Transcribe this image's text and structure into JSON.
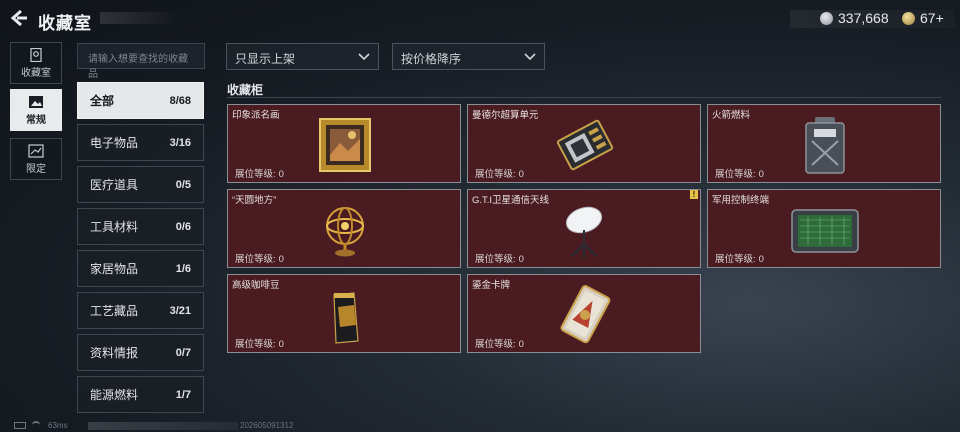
{
  "header": {
    "title": "收藏室",
    "currency_1": "337,668",
    "currency_2": "67+"
  },
  "rail": [
    {
      "label": "收藏室",
      "icon": "collection-room-icon"
    },
    {
      "label": "常规",
      "icon": "image-frame-icon"
    },
    {
      "label": "限定",
      "icon": "limited-icon"
    }
  ],
  "search": {
    "placeholder": "请输入想要查找的收藏品"
  },
  "filters": {
    "shelf": "只显示上架",
    "sort": "按价格降序"
  },
  "categories": [
    {
      "label": "全部",
      "count": "8/68"
    },
    {
      "label": "电子物品",
      "count": "3/16"
    },
    {
      "label": "医疗道具",
      "count": "0/5"
    },
    {
      "label": "工具材料",
      "count": "0/6"
    },
    {
      "label": "家居物品",
      "count": "1/6"
    },
    {
      "label": "工艺藏品",
      "count": "3/21"
    },
    {
      "label": "资料情报",
      "count": "0/7"
    },
    {
      "label": "能源燃料",
      "count": "1/7"
    }
  ],
  "cabinet": {
    "title": "收藏柜",
    "level_label": "展位等级:",
    "items": [
      {
        "name": "印象派名画",
        "level": "0",
        "icon": "framed-painting-icon"
      },
      {
        "name": "曼德尔超算单元",
        "level": "0",
        "icon": "computing-unit-icon"
      },
      {
        "name": "火箭燃料",
        "level": "0",
        "icon": "fuel-canister-icon"
      },
      {
        "name": "“天圆地方”",
        "level": "0",
        "icon": "armillary-sphere-icon"
      },
      {
        "name": "G.T.I卫星通信天线",
        "level": "0",
        "icon": "satellite-dish-icon",
        "badge": "!"
      },
      {
        "name": "军用控制终端",
        "level": "0",
        "icon": "control-terminal-icon"
      },
      {
        "name": "高级咖啡豆",
        "level": "0",
        "icon": "coffee-bag-icon"
      },
      {
        "name": "鎏金卡牌",
        "level": "0",
        "icon": "gilded-card-icon"
      }
    ]
  },
  "footer": {
    "ping": "63ms",
    "stamp": "202605091312"
  },
  "colors": {
    "card_bg": "#4a1c22",
    "accent_badge": "#e8c34a",
    "active_tab": "#f0f2f4"
  }
}
